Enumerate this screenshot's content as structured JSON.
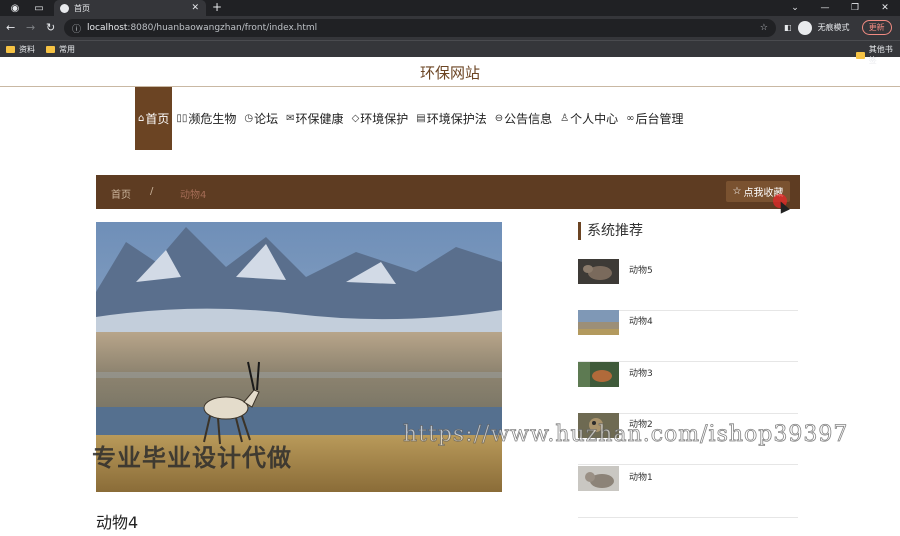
{
  "browser": {
    "tab_title": "首页",
    "url_host": "localhost",
    "url_rest": ":8080/huanbaowangzhan/front/index.html",
    "profile_label": "无痕模式",
    "update_label": "更新",
    "bookmarks": [
      "资料",
      "常用"
    ],
    "bookmarks_right": "其他书签"
  },
  "site": {
    "title": "环保网站"
  },
  "nav": {
    "items": [
      {
        "label": "首页",
        "icon": "home-icon"
      },
      {
        "label": "濒危生物",
        "icon": "book-icon"
      },
      {
        "label": "论坛",
        "icon": "clock-icon"
      },
      {
        "label": "环保健康",
        "icon": "mail-icon"
      },
      {
        "label": "环境保护",
        "icon": "tag-icon"
      },
      {
        "label": "环境保护法",
        "icon": "newspaper-icon"
      },
      {
        "label": "公告信息",
        "icon": "bell-icon"
      },
      {
        "label": "个人中心",
        "icon": "user-icon"
      },
      {
        "label": "后台管理",
        "icon": "link-icon"
      }
    ]
  },
  "breadcrumb": {
    "home": "首页",
    "separator": "/",
    "current": "动物4",
    "favorite_label": "点我收藏"
  },
  "detail": {
    "title": "动物4"
  },
  "recommend": {
    "heading": "系统推荐",
    "items": [
      "动物5",
      "动物4",
      "动物3",
      "动物2",
      "动物1"
    ]
  },
  "watermark": {
    "url": "https://www.huzhan.com/ishop39397",
    "text": "专业毕业设计代做"
  },
  "colors": {
    "brand": "#6b4423",
    "crumb_bar": "#5e3c22"
  }
}
